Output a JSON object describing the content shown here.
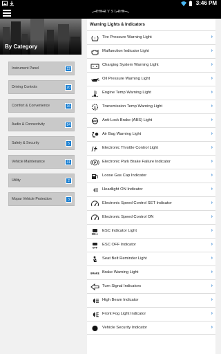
{
  "status": {
    "time": "3:46 PM"
  },
  "app": {
    "brand": "CHRYSLER"
  },
  "sidebar": {
    "title": "By Category",
    "categories": [
      {
        "label": "Instrument Panel",
        "count": "22"
      },
      {
        "label": "Driving Controls",
        "count": "20"
      },
      {
        "label": "Comfort & Convenience",
        "count": "16"
      },
      {
        "label": "Audio & Connectivity",
        "count": "54"
      },
      {
        "label": "Safety & Security",
        "count": "5"
      },
      {
        "label": "Vehicle Maintenance",
        "count": "31"
      },
      {
        "label": "Utility",
        "count": "2"
      },
      {
        "label": "Mopar Vehicle Protection",
        "count": "3"
      }
    ]
  },
  "list": {
    "title": "Warning Lights & Indicators",
    "items": [
      {
        "label": "Tire Pressure Warning Light",
        "icon": "tire-pressure-icon"
      },
      {
        "label": "Malfunction Indicator Light",
        "icon": "engine-icon"
      },
      {
        "label": "Charging System Warning Light",
        "icon": "battery-icon"
      },
      {
        "label": "Oil Pressure Warning Light",
        "icon": "oil-can-icon"
      },
      {
        "label": "Engine Temp Warning Light",
        "icon": "thermometer-icon"
      },
      {
        "label": "Transmission Temp Warning Light",
        "icon": "transmission-temp-icon"
      },
      {
        "label": "Anti-Lock Brake (ABS) Light",
        "icon": "abs-icon"
      },
      {
        "label": "Air Bag Warning Light",
        "icon": "airbag-icon"
      },
      {
        "label": "Electronic Throttle Control Light",
        "icon": "throttle-icon"
      },
      {
        "label": "Electronic Park Brake Failure Indicator",
        "icon": "park-brake-icon"
      },
      {
        "label": "Loose Gas Cap Indicator",
        "icon": "gas-cap-icon"
      },
      {
        "label": "Headlight ON Indicator",
        "icon": "headlight-icon"
      },
      {
        "label": "Electronic Speed Control SET Indicator",
        "icon": "speed-control-set-icon"
      },
      {
        "label": "Electronic Speed Control ON",
        "icon": "speed-control-on-icon"
      },
      {
        "label": "ESC Indicator Light",
        "icon": "esc-icon"
      },
      {
        "label": "ESC OFF Indicator",
        "icon": "esc-off-icon"
      },
      {
        "label": "Seat Belt Reminder Light",
        "icon": "seat-belt-icon"
      },
      {
        "label": "Brake Warning Light",
        "icon": "brake-icon",
        "icon_text": "BRAKE"
      },
      {
        "label": "Turn Signal Indicators",
        "icon": "turn-signal-icon"
      },
      {
        "label": "High Beam Indicator",
        "icon": "high-beam-icon"
      },
      {
        "label": "Front Fog Light Indicator",
        "icon": "fog-light-icon"
      },
      {
        "label": "Vehicle Security Indicator",
        "icon": "security-dot-icon"
      }
    ]
  },
  "colors": {
    "accent": "#2a7fd0",
    "badge": "#1a7fd1",
    "category_bg": "#c9c9c9"
  }
}
